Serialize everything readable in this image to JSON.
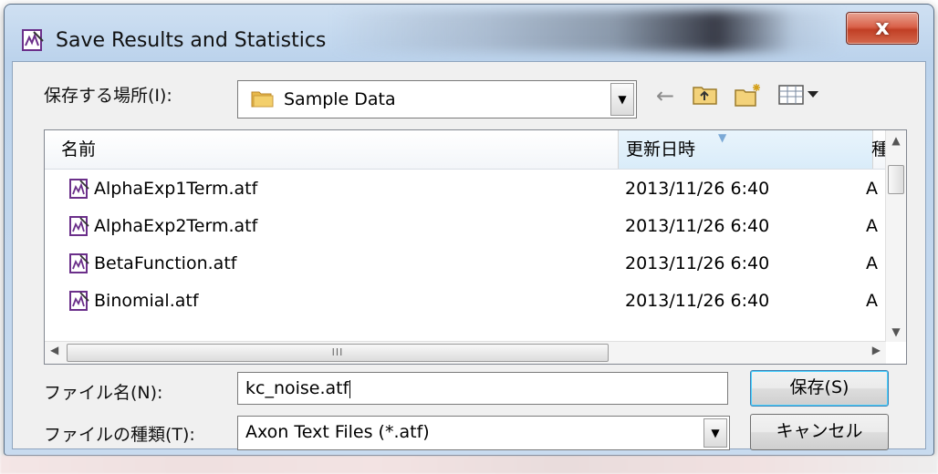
{
  "window": {
    "title": "Save Results and Statistics",
    "close_glyph": "x"
  },
  "lookin": {
    "label": "保存する場所(I):",
    "value": "Sample Data",
    "icon": "folder-icon"
  },
  "toolbar": {
    "back_glyph": "←",
    "up_icon": "up-folder-icon",
    "new_folder_icon": "new-folder-icon",
    "view_icon": "view-menu-icon"
  },
  "list": {
    "columns": {
      "name": "名前",
      "date": "更新日時",
      "type": "種"
    },
    "rows": [
      {
        "name": "AlphaExp1Term.atf",
        "date": "2013/11/26 6:40",
        "type": "A"
      },
      {
        "name": "AlphaExp2Term.atf",
        "date": "2013/11/26 6:40",
        "type": "A"
      },
      {
        "name": "BetaFunction.atf",
        "date": "2013/11/26 6:40",
        "type": "A"
      },
      {
        "name": "Binomial.atf",
        "date": "2013/11/26 6:40",
        "type": "A"
      }
    ],
    "hscroll_grip": "III"
  },
  "filename": {
    "label": "ファイル名(N):",
    "value": "kc_noise.atf"
  },
  "filetype": {
    "label": "ファイルの種類(T):",
    "value": "Axon Text Files (*.atf)"
  },
  "buttons": {
    "save": "保存(S)",
    "cancel": "キャンセル"
  },
  "colors": {
    "close_red": "#c13f25",
    "header_sorted": "#d9ecf9",
    "focus_blue": "#48d1ff"
  }
}
